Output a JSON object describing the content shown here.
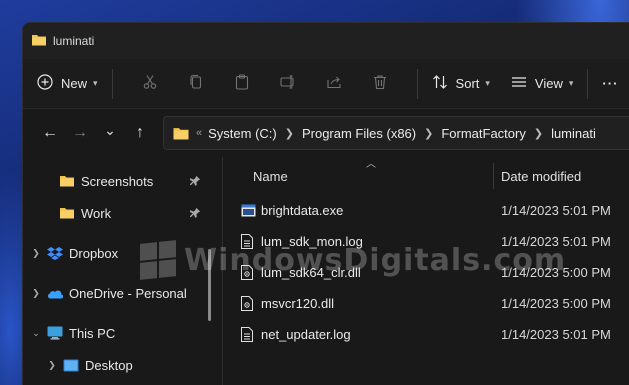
{
  "window": {
    "title": "luminati"
  },
  "toolbar": {
    "new_label": "New",
    "sort_label": "Sort",
    "view_label": "View",
    "more_label": "···"
  },
  "nav_buttons": {
    "back": "←",
    "forward": "→",
    "recent": "⌄",
    "up": "↑"
  },
  "address": {
    "overflow": "«",
    "crumbs": [
      "System (C:)",
      "Program Files (x86)",
      "FormatFactory",
      "luminati"
    ]
  },
  "sidebar": {
    "items": [
      {
        "label": "Screenshots",
        "icon": "folder-icon"
      },
      {
        "label": "Work",
        "icon": "folder-icon"
      },
      {
        "label": "Dropbox",
        "icon": "dropbox-icon"
      },
      {
        "label": "OneDrive - Personal",
        "icon": "onedrive-icon"
      },
      {
        "label": "This PC",
        "icon": "pc-icon"
      },
      {
        "label": "Desktop",
        "icon": "desktop-icon"
      }
    ]
  },
  "columns": {
    "name": "Name",
    "date": "Date modified"
  },
  "files": [
    {
      "name": "brightdata.exe",
      "date": "1/14/2023 5:01 PM",
      "icon": "exe-icon"
    },
    {
      "name": "lum_sdk_mon.log",
      "date": "1/14/2023 5:01 PM",
      "icon": "log-file-icon"
    },
    {
      "name": "lum_sdk64_clr.dll",
      "date": "1/14/2023 5:00 PM",
      "icon": "dll-file-icon"
    },
    {
      "name": "msvcr120.dll",
      "date": "1/14/2023 5:00 PM",
      "icon": "dll-file-icon"
    },
    {
      "name": "net_updater.log",
      "date": "1/14/2023 5:01 PM",
      "icon": "log-file-icon"
    }
  ],
  "watermark": {
    "text": "WindowsDigitals.com"
  },
  "colors": {
    "folder": "#f2c14e",
    "window_bg": "#191919",
    "titlebar_bg": "#202020"
  }
}
